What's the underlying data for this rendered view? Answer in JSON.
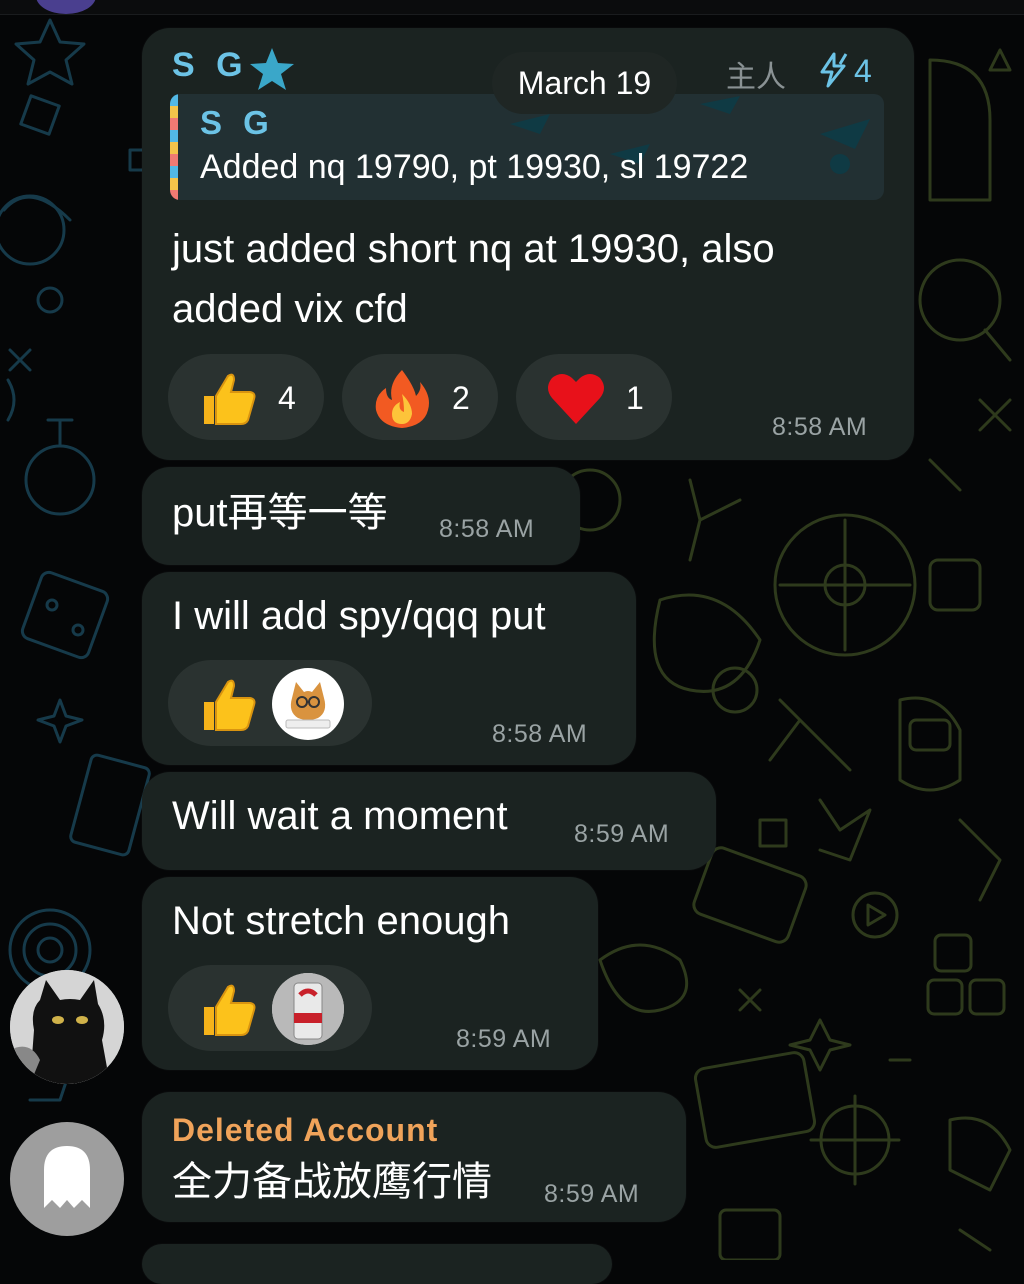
{
  "date_separator": "March 19",
  "messages": [
    {
      "sender": "S G",
      "role_badge": "主人",
      "boost_count": "4",
      "reply_to": {
        "sender": "S G",
        "text": "Added nq 19790, pt 19930, sl 19722"
      },
      "text_line1": "just added short nq at 19930, also",
      "text_line2": "added vix cfd",
      "reactions": [
        {
          "emoji": "thumbs-up",
          "count": "4"
        },
        {
          "emoji": "fire",
          "count": "2"
        },
        {
          "emoji": "red-heart",
          "count": "1"
        }
      ],
      "time": "8:58 AM"
    },
    {
      "text": "put再等一等",
      "time": "8:58 AM"
    },
    {
      "text": "I will add spy/qqq put",
      "reactions": [
        {
          "emoji": "thumbs-up",
          "reactor": "cat-avatar"
        }
      ],
      "time": "8:58 AM"
    },
    {
      "text": "Will wait a moment",
      "time": "8:59 AM"
    },
    {
      "text": "Not stretch enough",
      "reactions": [
        {
          "emoji": "thumbs-up",
          "reactor": "drink-can-avatar"
        }
      ],
      "time": "8:59 AM"
    },
    {
      "sender": "Deleted Account",
      "text": "全力备战放鹰行情",
      "time": "8:59 AM"
    }
  ],
  "colors": {
    "sender_blue": "#6cc3e6",
    "deleted_orange": "#f0a35a",
    "bubble": "#1b2321"
  }
}
